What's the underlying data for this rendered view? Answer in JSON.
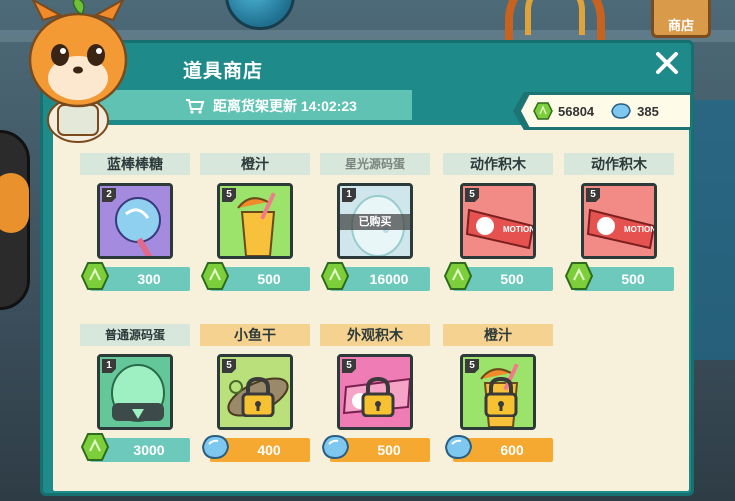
{
  "top_shop_label": "商店",
  "title": "道具商店",
  "timer_label": "距离货架更新 14:02:23",
  "currency": {
    "gem_green": "56804",
    "gem_blue": "385"
  },
  "colors": {
    "panel": "#1f8a8a",
    "inner": "#f7f1dc",
    "price_green": "#6cc9bb",
    "price_orange": "#f5a931"
  },
  "items": [
    {
      "name": "蓝棒棒糖",
      "level": "2",
      "price": "300",
      "currency": "green",
      "state": "available",
      "icon": "lollipop-icon"
    },
    {
      "name": "橙汁",
      "level": "5",
      "price": "500",
      "currency": "green",
      "state": "available",
      "icon": "orange-juice-icon"
    },
    {
      "name": "星光源码蛋",
      "level": "1",
      "price": "16000",
      "currency": "green",
      "state": "purchased",
      "purchased_label": "已购买",
      "icon": "star-egg-icon"
    },
    {
      "name": "动作积木",
      "level": "5",
      "price": "500",
      "currency": "green",
      "state": "available",
      "icon": "motion-block-icon"
    },
    {
      "name": "动作积木",
      "level": "5",
      "price": "500",
      "currency": "green",
      "state": "available",
      "icon": "motion-block-icon"
    },
    {
      "name": "普通源码蛋",
      "level": "1",
      "price": "3000",
      "currency": "green",
      "state": "available",
      "icon": "normal-egg-icon"
    },
    {
      "name": "小鱼干",
      "level": "5",
      "price": "400",
      "currency": "blue",
      "state": "locked",
      "icon": "dried-fish-icon"
    },
    {
      "name": "外观积木",
      "level": "5",
      "price": "500",
      "currency": "blue",
      "state": "locked",
      "icon": "look-block-icon"
    },
    {
      "name": "橙汁",
      "level": "5",
      "price": "600",
      "currency": "blue",
      "state": "locked",
      "icon": "orange-juice-icon"
    }
  ]
}
